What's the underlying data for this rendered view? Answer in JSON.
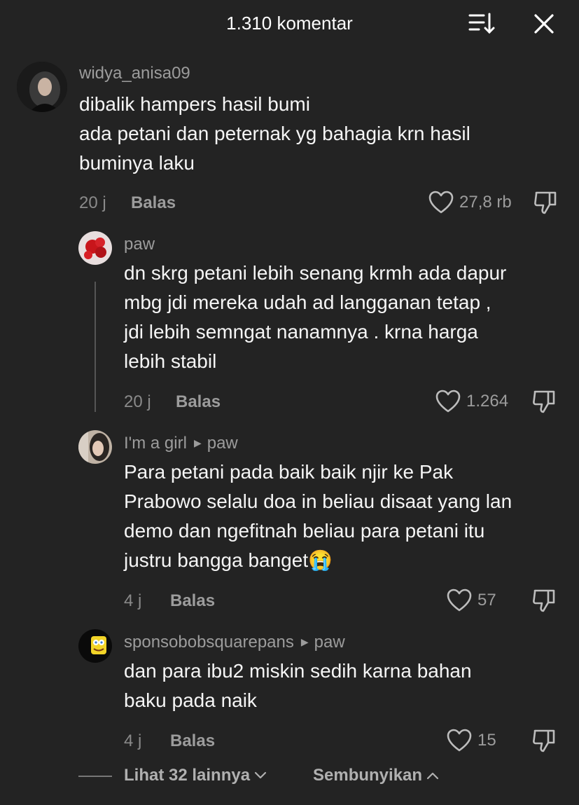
{
  "header": {
    "title": "1.310 komentar"
  },
  "comments": [
    {
      "username": "widya_anisa09",
      "reply_to": "",
      "lines": [
        "dibalik hampers hasil bumi",
        "ada petani dan peternak yg bahagia krn hasil",
        "buminya laku"
      ],
      "time": "20 j",
      "reply_label": "Balas",
      "likes": "27,8 rb"
    },
    {
      "username": "paw",
      "reply_to": "",
      "lines": [
        "dn skrg petani lebih senang krmh ada dapur",
        "mbg jdi mereka udah ad langganan tetap ,",
        "jdi lebih semngat nanamnya . krna harga",
        "lebih stabil"
      ],
      "time": "20 j",
      "reply_label": "Balas",
      "likes": "1.264"
    },
    {
      "username": "I'm a girl",
      "reply_to": "paw",
      "lines": [
        "Para petani pada baik baik njir ke Pak",
        "Prabowo selalu doa in beliau disaat yang lan",
        "demo dan ngefitnah beliau para petani itu",
        "justru bangga banget😭"
      ],
      "time": "4 j",
      "reply_label": "Balas",
      "likes": "57"
    },
    {
      "username": "sponsobobsquarepans",
      "reply_to": "paw",
      "lines": [
        "dan para ibu2 miskin sedih karna bahan",
        "baku pada naik"
      ],
      "time": "4 j",
      "reply_label": "Balas",
      "likes": "15"
    }
  ],
  "footer": {
    "view_more": "Lihat 32 lainnya",
    "hide": "Sembunyikan"
  },
  "icons": {
    "sort": "sort-icon",
    "close": "close-icon",
    "like": "heart-icon",
    "dislike": "thumbs-down-icon"
  }
}
